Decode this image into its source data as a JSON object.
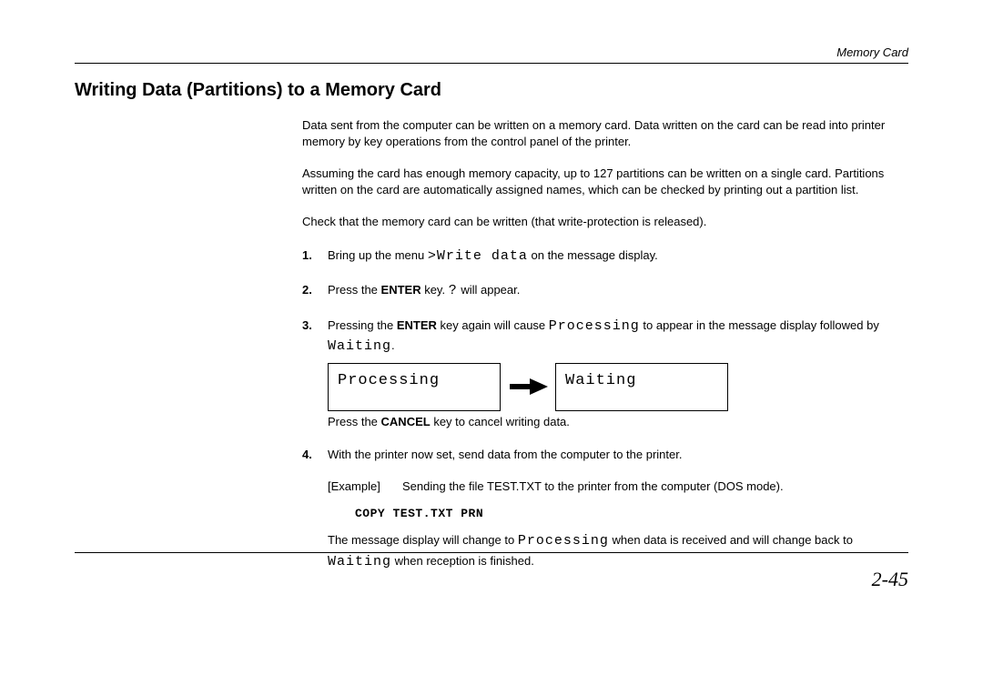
{
  "header": {
    "section": "Memory Card"
  },
  "title": "Writing Data (Partitions) to a Memory Card",
  "intro": {
    "p1": "Data sent from the computer can be written on a memory card.  Data written on the card can be read into printer memory by key operations from the control panel of the printer.",
    "p2": "Assuming the card has enough memory capacity, up to 127 partitions can be written on a single card. Partitions written on the card are automatically assigned names, which can be checked by printing out a partition list.",
    "p3": "Check that the memory card can be written (that write-protection is released)."
  },
  "steps": {
    "s1": {
      "num": "1.",
      "pre": "Bring up the menu ",
      "lcd": ">Write data",
      "post": " on the message display."
    },
    "s2": {
      "num": "2.",
      "pre": "Press the ",
      "bold": "ENTER",
      "mid": " key. ",
      "lcd": "?",
      "post": " will appear."
    },
    "s3": {
      "num": "3.",
      "pre": "Pressing the ",
      "bold": "ENTER",
      "mid": " key again will cause ",
      "lcd1": "Processing",
      "mid2": " to appear in the message display followed by ",
      "lcd2": "Waiting",
      "post": ".",
      "box1": "Processing",
      "box2": "Waiting",
      "cancel_pre": "Press the ",
      "cancel_bold": "CANCEL",
      "cancel_post": " key to cancel writing data."
    },
    "s4": {
      "num": "4.",
      "line1": "With the printer now set, send data from the computer to the printer.",
      "example_label": "[Example]",
      "example_text": "Sending the file TEST.TXT to the printer from the computer (DOS mode).",
      "command": "COPY TEST.TXT PRN",
      "tail_pre": "The message display will change to ",
      "tail_lcd1": "Processing",
      "tail_mid": " when data is received and will change back to ",
      "tail_lcd2": "Waiting",
      "tail_post": " when reception is finished."
    }
  },
  "footer": {
    "page": "2-45"
  }
}
